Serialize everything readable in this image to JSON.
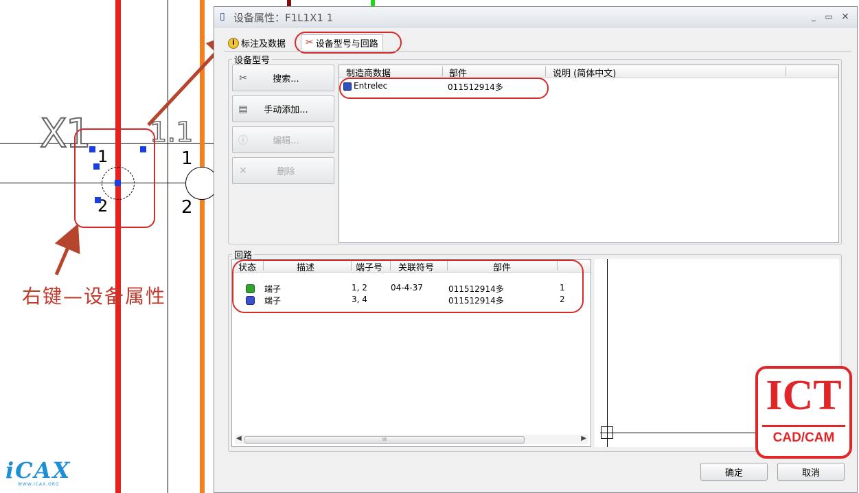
{
  "background": {
    "tag_label": "X1",
    "pin_top": "1",
    "pin_bottom": "2",
    "pin_top_b": "1",
    "pin_bottom_b": "2",
    "inner_label": "1",
    "colors": {
      "red_wire": "#e8211e",
      "orange_wire": "#f2801f",
      "green_mark": "#24d41a",
      "grip": "#1a3fe0"
    }
  },
  "annotation": {
    "text": "右键—设备属性",
    "color": "#c0392b"
  },
  "dialog": {
    "title": "设备属性：F1L1X1 1",
    "window_controls": [
      "_",
      "▭",
      "×"
    ],
    "tabs": [
      {
        "label": "标注及数据",
        "icon": "info-icon"
      },
      {
        "label": "设备型号与回路",
        "icon": "tools-icon"
      }
    ],
    "device_model_group": {
      "title": "设备型号",
      "buttons": [
        {
          "label": "搜索...",
          "icon": "tools-icon",
          "enabled": true
        },
        {
          "label": "手动添加...",
          "icon": "add-icon",
          "enabled": true
        },
        {
          "label": "编辑...",
          "icon": "info-icon",
          "enabled": false
        },
        {
          "label": "删除",
          "icon": "delete-icon",
          "enabled": false
        }
      ],
      "columns": [
        "制造商数据",
        "部件",
        "说明 (简体中文)"
      ],
      "rows": [
        {
          "manufacturer": "Entrelec",
          "part": "011512914多",
          "description": ""
        }
      ]
    },
    "circuit_group": {
      "title": "回路",
      "columns": [
        "状态",
        "描述",
        "端子号",
        "关联符号",
        "部件"
      ],
      "rows": [
        {
          "status": "green",
          "desc": "端子",
          "terminals": "1, 2",
          "assoc": "04-4-37",
          "part": "011512914多",
          "index": "1"
        },
        {
          "status": "blue",
          "desc": "端子",
          "terminals": "3, 4",
          "assoc": "",
          "part": "011512914多",
          "index": "2"
        }
      ],
      "scroll_thumb": "III"
    },
    "ok_label": "确定",
    "cancel_label": "取消"
  },
  "logos": {
    "icax_text": "iCAX",
    "icax_sub": "WWW.ICAX.ORG",
    "ict_text": "ICT",
    "ict_sub": "CAD/CAM"
  }
}
